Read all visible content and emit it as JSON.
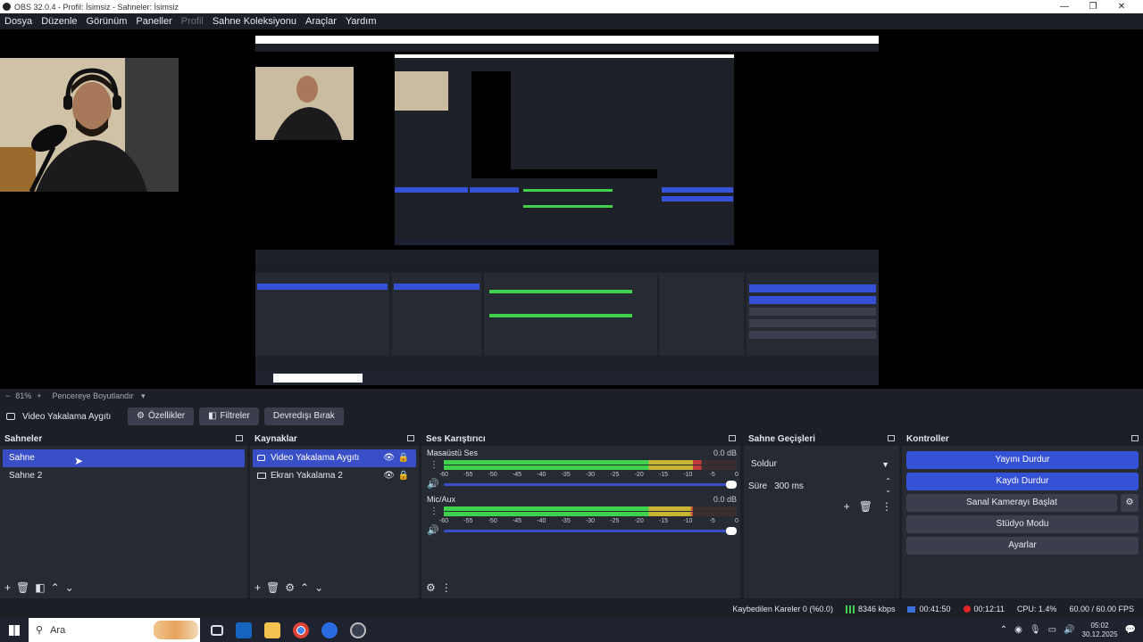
{
  "window": {
    "title": "OBS 32.0.4 - Profil: İsimsiz - Sahneler: İsimsiz",
    "min": "—",
    "max": "❐",
    "close": "✕"
  },
  "menu": [
    {
      "label": "Dosya"
    },
    {
      "label": "Düzenle"
    },
    {
      "label": "Görünüm"
    },
    {
      "label": "Paneller"
    },
    {
      "label": "Profil"
    },
    {
      "label": "Sahne Koleksiyonu"
    },
    {
      "label": "Araçlar"
    },
    {
      "label": "Yardım"
    }
  ],
  "preview_status": {
    "minus": "−",
    "zoom": "81%",
    "plus": "+",
    "fit_label": "Pencereye Boyutlandır"
  },
  "source_toolbar": {
    "source_name": "Video Yakalama Aygıtı",
    "properties": "Özellikler",
    "filters": "Filtreler",
    "deactivate": "Devredışı Bırak"
  },
  "scenes": {
    "title": "Sahneler",
    "items": [
      {
        "label": "Sahne"
      },
      {
        "label": "Sahne 2"
      }
    ]
  },
  "sources": {
    "title": "Kaynaklar",
    "items": [
      {
        "label": "Video Yakalama Aygıtı"
      },
      {
        "label": "Ekran Yakalama 2"
      }
    ]
  },
  "mixer": {
    "title": "Ses Karıştırıcı",
    "channels": [
      {
        "name": "Masaüstü Ses",
        "db": "0.0 dB",
        "level": 0.88
      },
      {
        "name": "Mic/Aux",
        "db": "0.0 dB",
        "level": 0.84
      }
    ],
    "ticks": [
      "-60",
      "-55",
      "-50",
      "-45",
      "-40",
      "-35",
      "-30",
      "-25",
      "-20",
      "-15",
      "-10",
      "-5",
      "0"
    ]
  },
  "transitions": {
    "title": "Sahne Geçişleri",
    "selected": "Soldur",
    "duration_label": "Süre",
    "duration_value": "300 ms"
  },
  "controls": {
    "title": "Kontroller",
    "stop_stream": "Yayını Durdur",
    "stop_record": "Kaydı Durdur",
    "virtual_cam": "Sanal Kamerayı Başlat",
    "studio_mode": "Stüdyo Modu",
    "settings": "Ayarlar"
  },
  "statusbar": {
    "dropped": "Kaybedilen Kareler 0 (%0.0)",
    "bitrate": "8346 kbps",
    "stream_time": "00:41:50",
    "rec_time": "00:12:11",
    "cpu": "CPU: 1.4%",
    "fps": "60.00 / 60.00 FPS"
  },
  "taskbar": {
    "search_placeholder": "Ara",
    "time": "05:02",
    "date": "30.12.2025"
  },
  "colors": {
    "accent": "#384fc8",
    "meter_green": "#3fd34b",
    "meter_yellow": "#c9b534",
    "meter_red": "#c23a3a"
  }
}
